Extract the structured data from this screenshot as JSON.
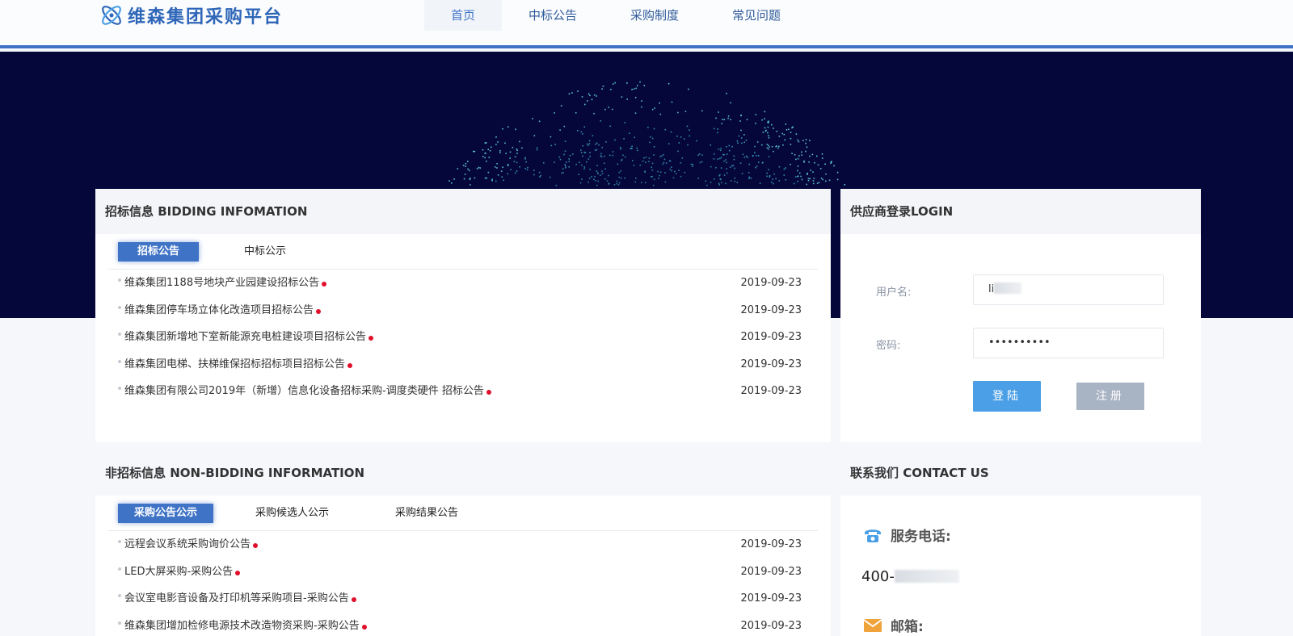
{
  "header": {
    "logo_text": "维森集团采购平台",
    "nav": [
      "首页",
      "中标公告",
      "采购制度",
      "常见问题"
    ]
  },
  "bidding": {
    "title": "招标信息 BIDDING INFOMATION",
    "tabs": [
      "招标公告",
      "中标公示"
    ],
    "rows": [
      {
        "title": "维森集团1188号地块产业园建设招标公告",
        "date": "2019-09-23"
      },
      {
        "title": "维森集团停车场立体化改造项目招标公告",
        "date": "2019-09-23"
      },
      {
        "title": "维森集团新增地下室新能源充电桩建设项目招标公告",
        "date": "2019-09-23"
      },
      {
        "title": "维森集团电梯、扶梯维保招标招标项目招标公告",
        "date": "2019-09-23"
      },
      {
        "title": "维森集团有限公司2019年（新增）信息化设备招标采购-调度类硬件 招标公告",
        "date": "2019-09-23"
      }
    ]
  },
  "login": {
    "title": "供应商登录LOGIN",
    "username_label": "用户名:",
    "username_value": "li",
    "password_label": "密码:",
    "password_value": "••••••••••",
    "login_button": "登陆",
    "register_button": "注册"
  },
  "nonbidding": {
    "title": "非招标信息 NON-BIDDING INFORMATION",
    "tabs": [
      "采购公告公示",
      "采购候选人公示",
      "采购结果公告"
    ],
    "rows": [
      {
        "title": "远程会议系统采购询价公告",
        "date": "2019-09-23"
      },
      {
        "title": "LED大屏采购-采购公告",
        "date": "2019-09-23"
      },
      {
        "title": "会议室电影音设备及打印机等采购项目-采购公告",
        "date": "2019-09-23"
      },
      {
        "title": "维森集团增加检修电源技术改造物资采购-采购公告",
        "date": "2019-09-23"
      }
    ]
  },
  "contact": {
    "title": "联系我们 CONTACT US",
    "phone_label": "服务电话:",
    "phone_prefix": "400-",
    "email_label": "邮箱:"
  },
  "colors": {
    "brand": "#3f73c6",
    "banner": "#05063a",
    "new_dot": "#e0102a",
    "login_btn": "#4a9fe6",
    "register_btn": "#a8b3c3"
  }
}
